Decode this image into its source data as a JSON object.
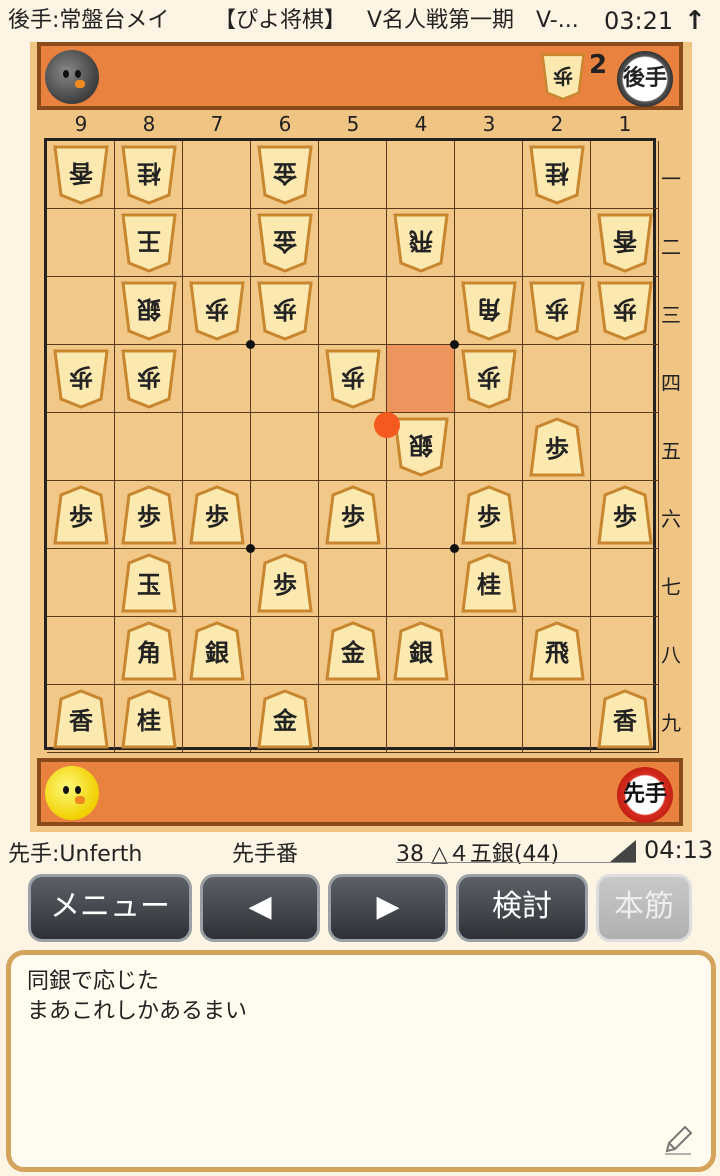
{
  "top_bar": {
    "opponent": "後手:常盤台メイ",
    "app_name": "【ぴよ将棋】",
    "game_title": "V名人戦第一期　V-...",
    "time": "03:21",
    "arrow_icon": "up-arrow-icon"
  },
  "gote": {
    "badge": "後手",
    "hand_piece": "歩",
    "hand_count": "2",
    "avatar_icon": "gray-chick-avatar-icon"
  },
  "sente": {
    "badge": "先手",
    "avatar_icon": "yellow-chick-avatar-icon"
  },
  "board": {
    "files": [
      "9",
      "8",
      "7",
      "6",
      "5",
      "4",
      "3",
      "2",
      "1"
    ],
    "ranks": [
      "一",
      "二",
      "三",
      "四",
      "五",
      "六",
      "七",
      "八",
      "九"
    ],
    "highlight_square": "44",
    "pieces": [
      {
        "sq": "91",
        "p": "香",
        "side": "gote"
      },
      {
        "sq": "81",
        "p": "桂",
        "side": "gote"
      },
      {
        "sq": "61",
        "p": "金",
        "side": "gote"
      },
      {
        "sq": "21",
        "p": "桂",
        "side": "gote"
      },
      {
        "sq": "82",
        "p": "王",
        "side": "gote"
      },
      {
        "sq": "62",
        "p": "金",
        "side": "gote"
      },
      {
        "sq": "42",
        "p": "飛",
        "side": "gote"
      },
      {
        "sq": "12",
        "p": "香",
        "side": "gote"
      },
      {
        "sq": "83",
        "p": "銀",
        "side": "gote"
      },
      {
        "sq": "73",
        "p": "歩",
        "side": "gote"
      },
      {
        "sq": "63",
        "p": "歩",
        "side": "gote"
      },
      {
        "sq": "33",
        "p": "角",
        "side": "gote"
      },
      {
        "sq": "23",
        "p": "歩",
        "side": "gote"
      },
      {
        "sq": "13",
        "p": "歩",
        "side": "gote"
      },
      {
        "sq": "94",
        "p": "歩",
        "side": "gote"
      },
      {
        "sq": "84",
        "p": "歩",
        "side": "gote"
      },
      {
        "sq": "54",
        "p": "歩",
        "side": "gote"
      },
      {
        "sq": "34",
        "p": "歩",
        "side": "gote"
      },
      {
        "sq": "45",
        "p": "銀",
        "side": "gote"
      },
      {
        "sq": "25",
        "p": "歩",
        "side": "sente"
      },
      {
        "sq": "96",
        "p": "歩",
        "side": "sente"
      },
      {
        "sq": "86",
        "p": "歩",
        "side": "sente"
      },
      {
        "sq": "76",
        "p": "歩",
        "side": "sente"
      },
      {
        "sq": "56",
        "p": "歩",
        "side": "sente"
      },
      {
        "sq": "36",
        "p": "歩",
        "side": "sente"
      },
      {
        "sq": "16",
        "p": "歩",
        "side": "sente"
      },
      {
        "sq": "87",
        "p": "玉",
        "side": "sente"
      },
      {
        "sq": "67",
        "p": "歩",
        "side": "sente"
      },
      {
        "sq": "37",
        "p": "桂",
        "side": "sente"
      },
      {
        "sq": "88",
        "p": "角",
        "side": "sente"
      },
      {
        "sq": "78",
        "p": "銀",
        "side": "sente"
      },
      {
        "sq": "58",
        "p": "金",
        "side": "sente"
      },
      {
        "sq": "48",
        "p": "銀",
        "side": "sente"
      },
      {
        "sq": "28",
        "p": "飛",
        "side": "sente"
      },
      {
        "sq": "99",
        "p": "香",
        "side": "sente"
      },
      {
        "sq": "89",
        "p": "桂",
        "side": "sente"
      },
      {
        "sq": "69",
        "p": "金",
        "side": "sente"
      },
      {
        "sq": "19",
        "p": "香",
        "side": "sente"
      }
    ]
  },
  "info": {
    "sente_name": "先手:Unferth",
    "turn": "先手番",
    "move": "38 △４五銀(44)",
    "time": "04:13"
  },
  "buttons": {
    "menu": "メニュー",
    "prev": "◀",
    "next": "▶",
    "study": "検討",
    "honsuji": "本筋"
  },
  "comment": {
    "lines": [
      "同銀で応じた",
      "まあこれしかあるまい"
    ],
    "edit_icon": "pencil-icon"
  },
  "colors": {
    "komadai": "#e9813f",
    "board": "#f2c889",
    "highlight": "#ec955c",
    "last_move_dot": "#f45a1f",
    "sente_badge": "#d62b1e"
  }
}
